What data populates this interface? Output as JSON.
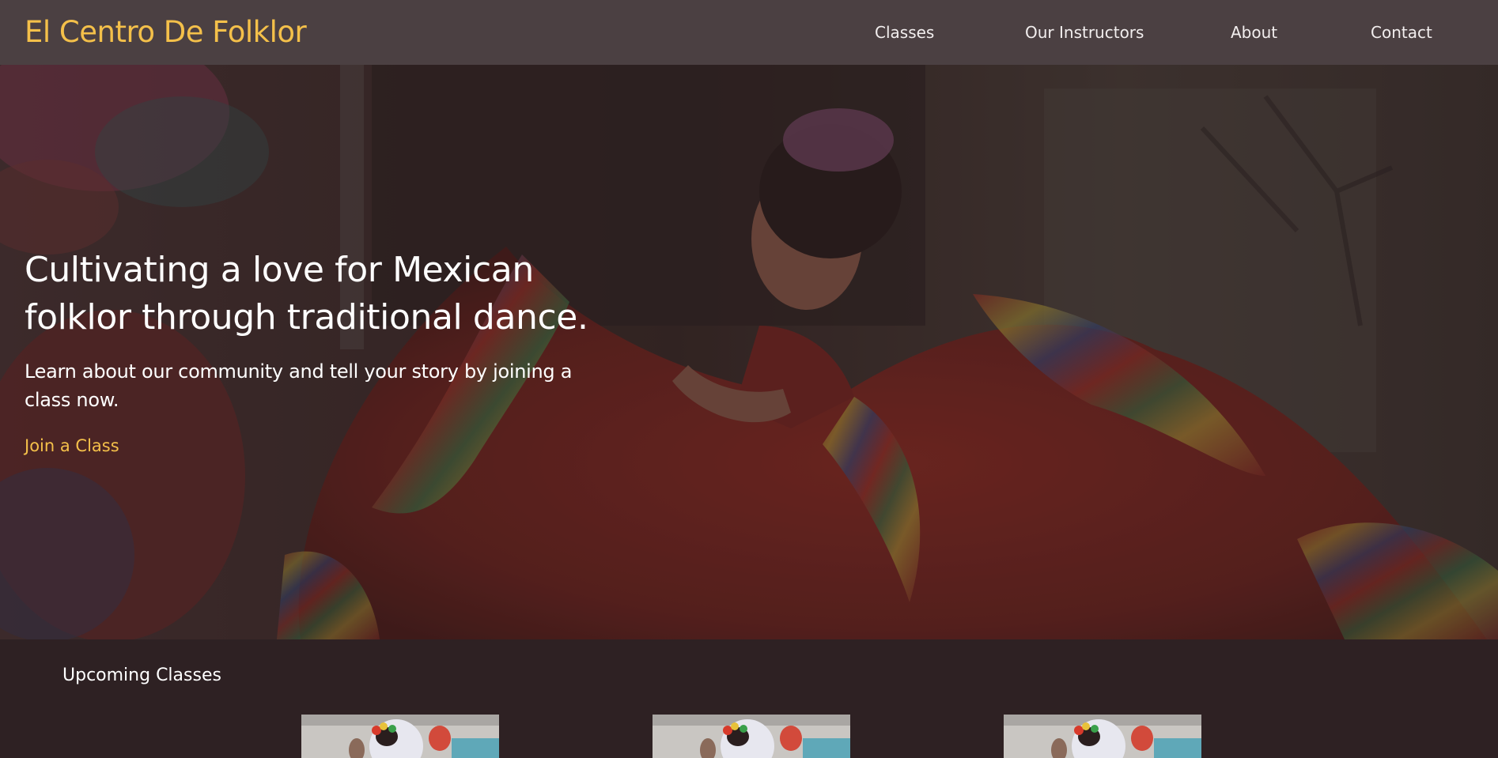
{
  "nav": {
    "brand": "El Centro De Folklor",
    "links": [
      {
        "label": "Classes"
      },
      {
        "label": "Our Instructors"
      },
      {
        "label": "About"
      },
      {
        "label": "Contact"
      }
    ]
  },
  "hero": {
    "title": "Cultivating a love for Mexican folklor through traditional dance.",
    "subtitle": "Learn about our community and tell your story by joining a class now.",
    "cta_label": "Join a Class"
  },
  "upcoming": {
    "title": "Upcoming Classes"
  },
  "colors": {
    "accent": "#f4c04a",
    "nav_bg": "#4b4042",
    "page_bg": "#2e2123",
    "text": "#ffffff"
  }
}
